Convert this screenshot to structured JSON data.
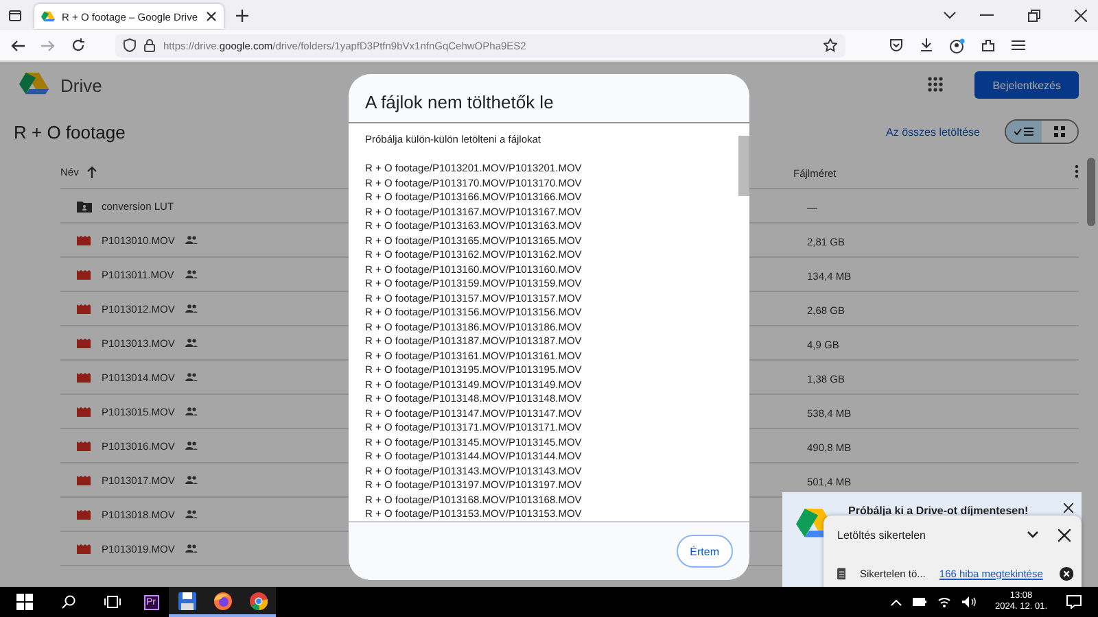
{
  "browser": {
    "tab_title": "R + O footage – Google Drive",
    "url": "https://drive.google.com/drive/folders/1yapfD3Ptfn9bVx1nfnGqCehwOPha9ES2"
  },
  "drive": {
    "app_name": "Drive",
    "sign_in": "Bejelentkezés",
    "folder_title": "R + O footage",
    "download_all": "Az összes letöltése",
    "views": [
      {
        "kind": "list",
        "selected": true
      },
      {
        "kind": "grid",
        "selected": false
      }
    ],
    "columns": {
      "name": "Név",
      "size": "Fájlméret"
    },
    "rows": [
      {
        "kind": "folder",
        "name": "conversion LUT",
        "shared": false,
        "size": "—"
      },
      {
        "kind": "video",
        "name": "P1013010.MOV",
        "shared": true,
        "size": "2,81 GB"
      },
      {
        "kind": "video",
        "name": "P1013011.MOV",
        "shared": true,
        "size": "134,4 MB"
      },
      {
        "kind": "video",
        "name": "P1013012.MOV",
        "shared": true,
        "size": "2,68 GB"
      },
      {
        "kind": "video",
        "name": "P1013013.MOV",
        "shared": true,
        "size": "4,9 GB"
      },
      {
        "kind": "video",
        "name": "P1013014.MOV",
        "shared": true,
        "size": "1,38 GB"
      },
      {
        "kind": "video",
        "name": "P1013015.MOV",
        "shared": true,
        "size": "538,4 MB"
      },
      {
        "kind": "video",
        "name": "P1013016.MOV",
        "shared": true,
        "size": "490,8 MB"
      },
      {
        "kind": "video",
        "name": "P1013017.MOV",
        "shared": true,
        "size": "501,4 MB"
      },
      {
        "kind": "video",
        "name": "P1013018.MOV",
        "shared": true
      },
      {
        "kind": "video",
        "name": "P1013019.MOV",
        "shared": true
      }
    ]
  },
  "dialog": {
    "title": "A fájlok nem tölthetők le",
    "intro": "Próbálja külön-külön letölteni a fájlokat",
    "button": "Értem",
    "files": [
      "R + O footage/P1013201.MOV/P1013201.MOV",
      "R + O footage/P1013170.MOV/P1013170.MOV",
      "R + O footage/P1013166.MOV/P1013166.MOV",
      "R + O footage/P1013167.MOV/P1013167.MOV",
      "R + O footage/P1013163.MOV/P1013163.MOV",
      "R + O footage/P1013165.MOV/P1013165.MOV",
      "R + O footage/P1013162.MOV/P1013162.MOV",
      "R + O footage/P1013160.MOV/P1013160.MOV",
      "R + O footage/P1013159.MOV/P1013159.MOV",
      "R + O footage/P1013157.MOV/P1013157.MOV",
      "R + O footage/P1013156.MOV/P1013156.MOV",
      "R + O footage/P1013186.MOV/P1013186.MOV",
      "R + O footage/P1013187.MOV/P1013187.MOV",
      "R + O footage/P1013161.MOV/P1013161.MOV",
      "R + O footage/P1013195.MOV/P1013195.MOV",
      "R + O footage/P1013149.MOV/P1013149.MOV",
      "R + O footage/P1013148.MOV/P1013148.MOV",
      "R + O footage/P1013147.MOV/P1013147.MOV",
      "R + O footage/P1013171.MOV/P1013171.MOV",
      "R + O footage/P1013145.MOV/P1013145.MOV",
      "R + O footage/P1013144.MOV/P1013144.MOV",
      "R + O footage/P1013143.MOV/P1013143.MOV",
      "R + O footage/P1013197.MOV/P1013197.MOV",
      "R + O footage/P1013168.MOV/P1013168.MOV",
      "R + O footage/P1013153.MOV/P1013153.MOV"
    ]
  },
  "promo": {
    "text": "Próbálja ki a Drive-ot díjmentesen!"
  },
  "download_panel": {
    "title": "Letöltés sikertelen",
    "item_status": "Sikertelen tö...",
    "item_link": "166 hiba megtekintése"
  },
  "taskbar": {
    "apps": [
      {
        "kind": "premiere",
        "label": "Pr"
      },
      {
        "kind": "save"
      },
      {
        "kind": "firefox"
      },
      {
        "kind": "chrome"
      }
    ],
    "time": "13:08",
    "date": "2024. 12. 01."
  }
}
